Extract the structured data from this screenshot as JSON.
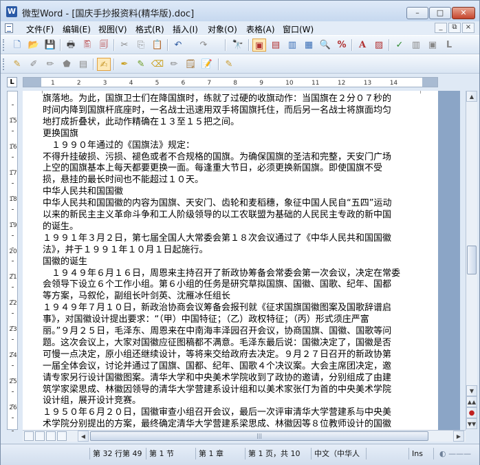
{
  "window": {
    "title": "微型Word - [国庆手抄报资料(精华版).doc]",
    "app_icon_letter": "W",
    "minimize_glyph": "–",
    "maximize_glyph": "□",
    "close_glyph": "✕"
  },
  "menubar": {
    "items": [
      "文件(F)",
      "编辑(E)",
      "视图(V)",
      "格式(R)",
      "插入(I)",
      "对象(O)",
      "表格(A)",
      "窗口(W)"
    ],
    "mdi_minimize": "_",
    "mdi_restore": "⧉",
    "mdi_close": "×"
  },
  "toolbar1": {
    "buttons": [
      {
        "icon": "new-document-icon",
        "glyph": "🗋"
      },
      {
        "icon": "open-folder-icon",
        "glyph": "📂"
      },
      {
        "icon": "save-icon",
        "glyph": "💾"
      },
      {
        "icon": "print-icon",
        "glyph": "🖶"
      },
      {
        "icon": "print-preview-icon",
        "glyph": "🖺"
      },
      {
        "icon": "copy-format-icon",
        "glyph": "🗐"
      },
      {
        "icon": "cut-icon",
        "glyph": "✂"
      },
      {
        "icon": "copy-icon",
        "glyph": "⎘"
      },
      {
        "icon": "paste-icon",
        "glyph": "📋"
      },
      {
        "icon": "undo-icon",
        "glyph": "↶"
      },
      {
        "icon": "redo-icon",
        "glyph": "↷"
      },
      {
        "icon": "find-icon",
        "glyph": "🔭"
      },
      {
        "icon": "page-view-icon",
        "glyph": "▣"
      },
      {
        "icon": "page-width-icon",
        "glyph": "▤"
      },
      {
        "icon": "full-page-icon",
        "glyph": "▥"
      },
      {
        "icon": "two-pages-icon",
        "glyph": "▦"
      },
      {
        "icon": "zoom-icon",
        "glyph": "🔍"
      },
      {
        "icon": "zoom-percent-icon",
        "glyph": "%"
      },
      {
        "icon": "font-icon",
        "glyph": "A"
      },
      {
        "icon": "picture-icon",
        "glyph": "▨"
      },
      {
        "icon": "spell-check-icon",
        "glyph": "✓"
      },
      {
        "icon": "word-count-icon",
        "glyph": "▥"
      },
      {
        "icon": "window-icon",
        "glyph": "▣"
      },
      {
        "icon": "text-box-icon",
        "glyph": "L"
      }
    ]
  },
  "toolbar2": {
    "buttons": [
      {
        "icon": "edit-object-icon",
        "glyph": "✎"
      },
      {
        "icon": "object-properties-icon",
        "glyph": "✐"
      },
      {
        "icon": "draw-icon",
        "glyph": "✏"
      },
      {
        "icon": "shape-icon",
        "glyph": "⬟"
      },
      {
        "icon": "object-list-icon",
        "glyph": "▤"
      },
      {
        "icon": "highlighter-icon",
        "glyph": "✍"
      },
      {
        "icon": "pen-icon",
        "glyph": "✒"
      },
      {
        "icon": "marker-icon",
        "glyph": "✎"
      },
      {
        "icon": "eraser-icon",
        "glyph": "⌫"
      },
      {
        "icon": "pencil-icon",
        "glyph": "✏"
      },
      {
        "icon": "notes-icon",
        "glyph": "🗒"
      },
      {
        "icon": "document-edit-icon",
        "glyph": "📝"
      }
    ]
  },
  "ruler": {
    "corner_label": "L",
    "ticks": [
      "1",
      "2",
      "3",
      "4",
      "5",
      "6",
      "7",
      "8",
      "9",
      "10",
      "11",
      "12",
      "13",
      "14"
    ],
    "vertical_numbers": [
      "15",
      "16",
      "17",
      "18",
      "19",
      "20",
      "21",
      "22",
      "23",
      "24",
      "25",
      "26"
    ]
  },
  "document": {
    "lines": [
      "旗落地。为此，国旗卫士们在降国旗时，练就了过硬的收旗动作：当国旗在２分０７秒的",
      "时间内降到国旗杆底座时，一名战士迅速用双手将国旗托住，而后另一名战士将旗面均匀",
      "地打成折叠状，此动作精确在１３至１５把之间。",
      "更换国旗",
      "　１９９０年通过的《国旗法》规定：",
      "不得升挂破损、污损、褪色或者不合规格的国旗。为确保国旗的圣洁和完整，天安门广场",
      "上空的国旗基本上每天都要更换一面。每逢重大节日，必须更换新国旗。即使国旗不受",
      "损，悬挂的最长时间也不能超过１０天。",
      "中华人民共和国国徽",
      "  中华人民共和国国徽的内容为国旗、天安门、齿轮和麦稻穗，象征中国人民自“五四”运动",
      "以来的新民主主义革命斗争和工人阶级领导的以工农联盟为基础的人民民主专政的新中国",
      "的诞生。",
      "１９９１年３月２日，第七届全国人大常委会第１８次会议通过了《中华人民共和国国徽",
      "法》，并于１９９１年１０月１日起施行。",
      "国徽的诞生",
      "　１９４９年６月１６日，周恩来主持召开了新政协筹备会常委会第一次会议，决定在常委",
      "会领导下设立６个工作小组。第６小组的任务是研究草拟国旗、国徽、国歌、纪年、国都",
      "等方案，马叙伦，副组长叶剑英、沈雁冰任组长",
      "１９４９年７月１０日，新政治协商会议筹备会报刊就《征求国旗国徽图案及国歌辞谱启",
      "事》，对国徽设计提出要求：“（甲）中国特征；（乙）政权特征；（丙）形式须庄严富",
      "丽。”９月２５日，毛泽东、周恩来在中南海丰泽园召开会议，协商国旗、国徽、国歌等问",
      "题。这次会议上，大家对国徽应征图稿都不满意。毛泽东最后说：国徽决定了，国徽是否",
      "可慢一点决定，原小组还继续设计，等将来交给政府去决定。９月２７日召开的新政协第",
      "一届全体会议，讨论并通过了国旗、国都、纪年、国歌４个决议案。大会主席团决定，邀",
      "请专家另行设计国徽图案。清华大学和中央美术学院收到了政协的邀请，分别组成了由建",
      "筑学家梁思成、林徽因领导的清华大学营建系设计组和以美术家张仃为首的中央美术学院",
      "设计组，展开设计竞赛。",
      "１９５０年６月２０日，国徽审查小组召开会议，最后一次评审清华大学营建系与中央美",
      "术学院分别提出的方案，最终确定清华大学营建系梁思成、林徽因等８位教师设计的国徽"
    ]
  },
  "status": {
    "cell0": "",
    "position": "第 32 行第 49",
    "section": "第 1 节",
    "chapter": "第 1 章",
    "page": "第 1 页，共 10",
    "language": "中文（中华人",
    "empty": "",
    "ins": "Ins"
  },
  "colors": {
    "title_bg": "#c6d8ef",
    "page_bg": "#8ba5c6",
    "close_red": "#c5442b"
  }
}
